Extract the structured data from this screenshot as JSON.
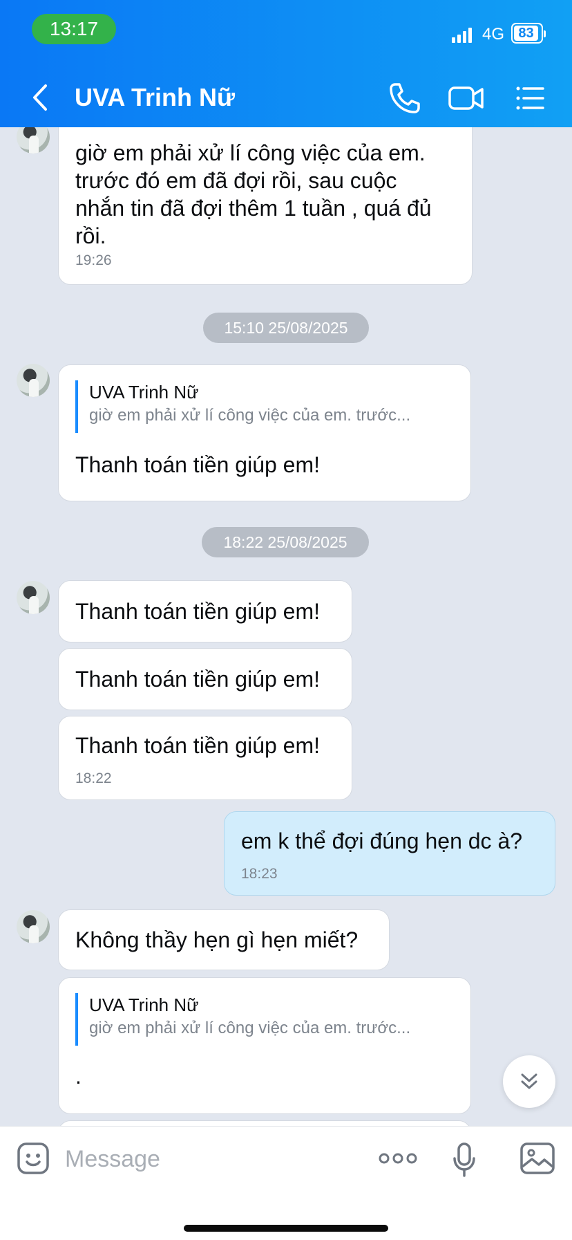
{
  "status_bar": {
    "time": "13:17",
    "network": "4G",
    "battery": "83"
  },
  "header": {
    "title": "UVA Trinh Nữ"
  },
  "chat": {
    "top_message": {
      "lines": [
        "giờ em phải xử lí công việc của em.",
        "trước đó em đã đợi rồi, sau cuộc",
        "nhắn tin đã đợi thêm 1 tuần , quá đủ",
        "rồi."
      ],
      "time": "19:26"
    },
    "date_separator_1": "15:10 25/08/2025",
    "reply_message_1": {
      "quote_author": "UVA Trinh Nữ",
      "quote_text": "giờ em phải xử lí công việc của em. trước...",
      "text": "Thanh toán tiền giúp em!"
    },
    "date_separator_2": "18:22 25/08/2025",
    "repeat_messages": [
      "Thanh toán tiền giúp em!",
      "Thanh toán tiền giúp em!",
      "Thanh toán tiền giúp em!"
    ],
    "repeat_time": "18:22",
    "my_message": {
      "text": "em k thể đợi đúng hẹn dc à?",
      "time": "18:23"
    },
    "reply_text": "Không thầy hẹn gì hẹn miết?",
    "reply_message_2": {
      "quote_author": "UVA Trinh Nữ",
      "quote_text": "giờ em phải xử lí công việc của em. trước...",
      "text": "."
    }
  },
  "composer": {
    "placeholder": "Message"
  }
}
